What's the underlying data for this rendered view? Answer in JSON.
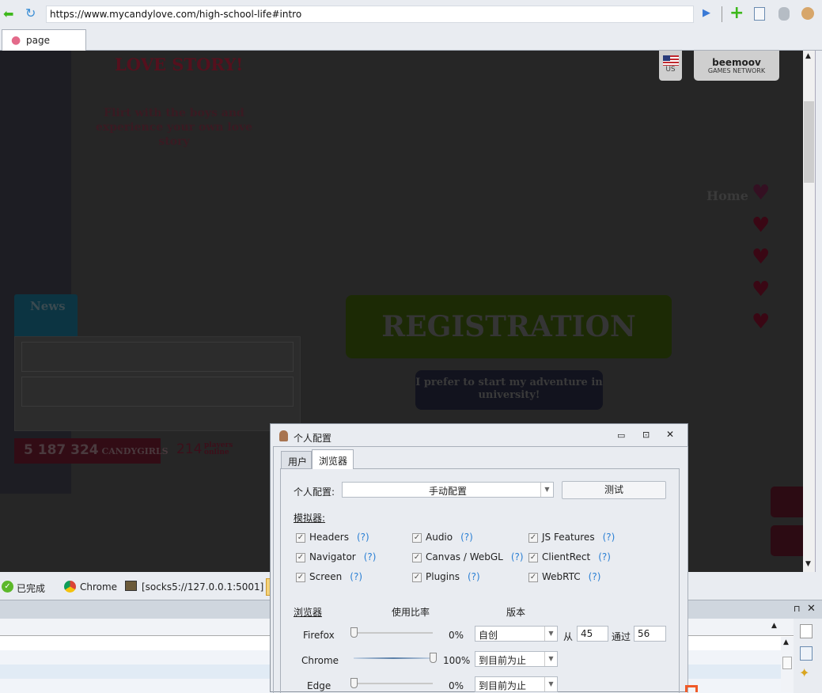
{
  "browser": {
    "url": "https://www.mycandylove.com/high-school-life#intro",
    "tab": "page"
  },
  "page": {
    "title": "LOVE STORY!",
    "subtitle_1": "Flirt with the boys and",
    "subtitle_2": "experience your own love story",
    "news": "News",
    "counter": "5 187 324",
    "counter_label": "CANDYGIRLS",
    "online": "214",
    "online_l1": "players",
    "online_l2": "online",
    "registration": "REGISTRATION",
    "university_1": "I prefer to start my adventure in",
    "university_2": "university!",
    "home": "Home",
    "flag_label": "US",
    "brand": "beemoov",
    "brand_sub": "GAMES NETWORK"
  },
  "status": {
    "done": "已完成",
    "browser": "Chrome",
    "proxy": "[socks5://127.0.0.1:5001]"
  },
  "dialog": {
    "title": "个人配置",
    "tabs": [
      "用户",
      "浏览器"
    ],
    "profile_label": "个人配置:",
    "profile_value": "手动配置",
    "test_button": "测试",
    "emulators_label": "模拟器:",
    "help": "(?)",
    "emulators": [
      {
        "label": "Headers",
        "checked": true
      },
      {
        "label": "Audio",
        "checked": true
      },
      {
        "label": "JS Features",
        "checked": true
      },
      {
        "label": "Navigator",
        "checked": true
      },
      {
        "label": "Canvas / WebGL",
        "checked": true
      },
      {
        "label": "ClientRect",
        "checked": true
      },
      {
        "label": "Screen",
        "checked": true
      },
      {
        "label": "Plugins",
        "checked": true
      },
      {
        "label": "WebRTC",
        "checked": true
      }
    ],
    "col_browser": "浏览器",
    "col_usage": "使用比率",
    "col_version": "版本",
    "browsers": [
      {
        "name": "Firefox",
        "usage": 0,
        "usage_text": "0%",
        "version": "自创",
        "from_label": "从",
        "from": "45",
        "to_label": "通过",
        "to": "56"
      },
      {
        "name": "Chrome",
        "usage": 100,
        "usage_text": "100%",
        "version": "到目前为止"
      },
      {
        "name": "Edge",
        "usage": 0,
        "usage_text": "0%",
        "version": "到目前为止"
      }
    ]
  },
  "colors": {
    "bg": "#e9ecf1",
    "page": "#262626",
    "accent": "#2a7fd4"
  }
}
